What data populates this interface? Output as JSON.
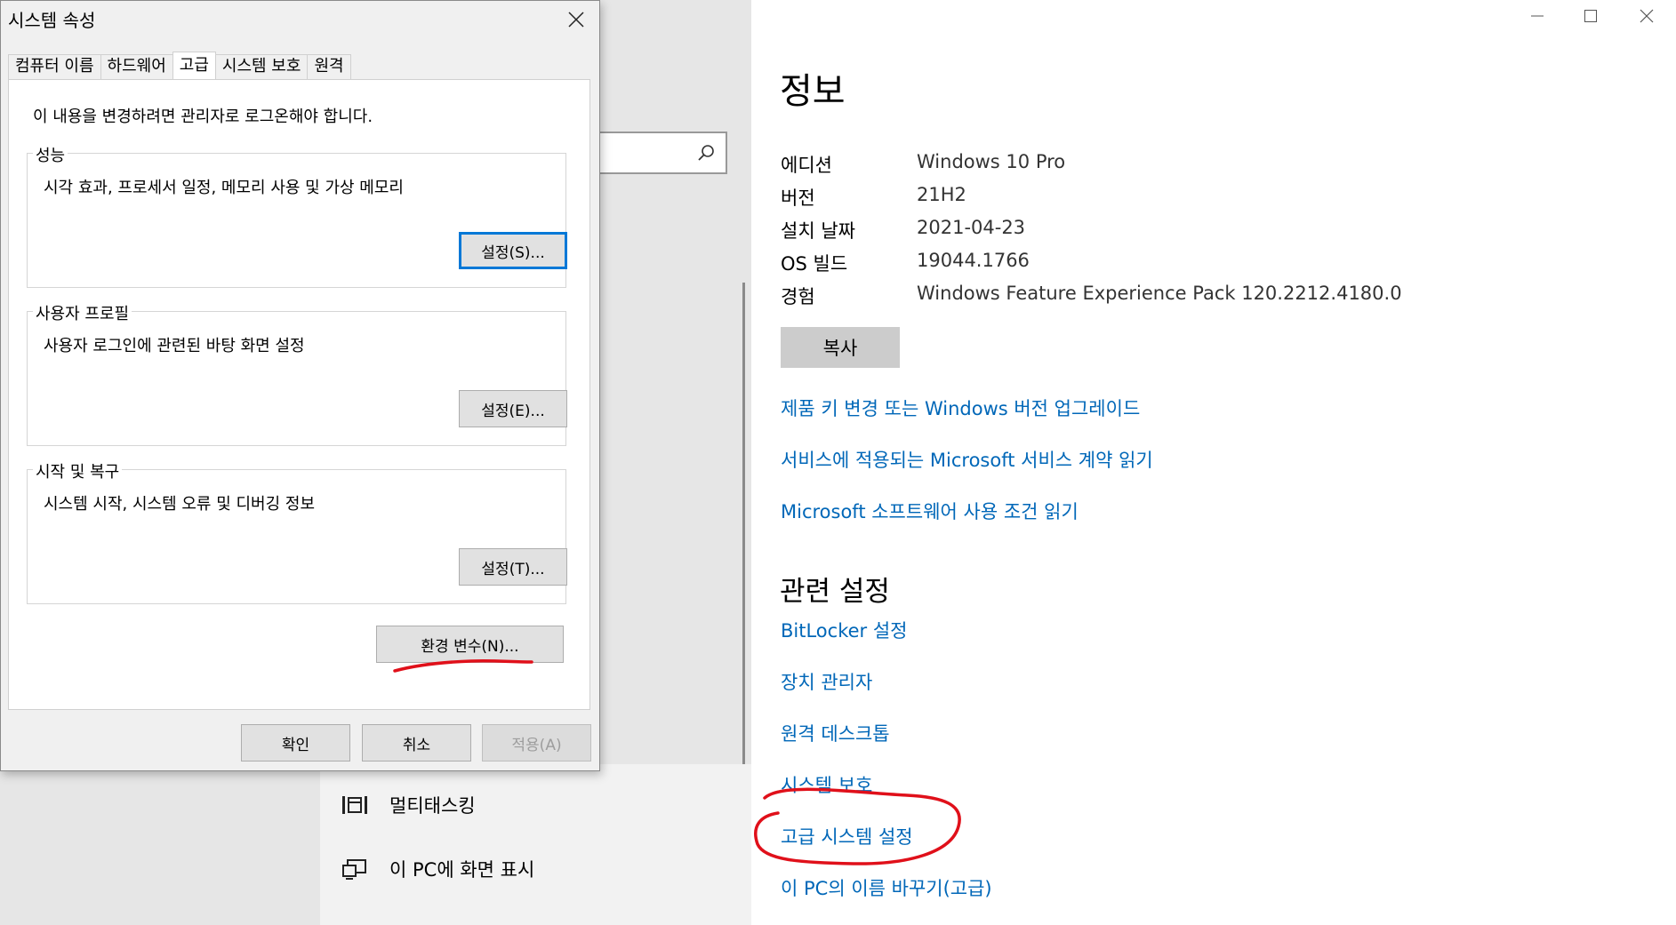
{
  "background": {
    "nav_items": [
      {
        "label": "멀티태스킹",
        "icon": "multitasking-icon"
      },
      {
        "label": "이 PC에 화면 표시",
        "icon": "project-icon"
      }
    ],
    "search_icon": "search-icon",
    "window_controls": [
      "minimize-icon",
      "maximize-icon",
      "close-icon"
    ],
    "title": "정보",
    "specs": [
      {
        "key": "에디션",
        "value": "Windows 10 Pro"
      },
      {
        "key": "버전",
        "value": "21H2"
      },
      {
        "key": "설치 날짜",
        "value": "2021-04-23"
      },
      {
        "key": "OS 빌드",
        "value": "19044.1766"
      },
      {
        "key": "경험",
        "value": "Windows Feature Experience Pack 120.2212.4180.0"
      }
    ],
    "copy_label": "복사",
    "links": [
      "제품 키 변경 또는 Windows 버전 업그레이드",
      "서비스에 적용되는 Microsoft 서비스 계약 읽기",
      "Microsoft 소프트웨어 사용 조건 읽기"
    ],
    "related_title": "관련 설정",
    "related_links": [
      "BitLocker 설정",
      "장치 관리자",
      "원격 데스크톱",
      "시스템 보호",
      "고급 시스템 설정",
      "이 PC의 이름 바꾸기(고급)"
    ],
    "link_color": "#0067b8"
  },
  "dialog": {
    "title": "시스템 속성",
    "tabs": [
      "컴퓨터 이름",
      "하드웨어",
      "고급",
      "시스템 보호",
      "원격"
    ],
    "active_tab": "고급",
    "admin_note": "이 내용을 변경하려면 관리자로 로그온해야 합니다.",
    "groups": [
      {
        "label": "성능",
        "desc": "시각 효과, 프로세서 일정, 메모리 사용 및 가상 메모리",
        "button": "설정(S)..."
      },
      {
        "label": "사용자 프로필",
        "desc": "사용자 로그인에 관련된 바탕 화면 설정",
        "button": "설정(E)..."
      },
      {
        "label": "시작 및 복구",
        "desc": "시스템 시작, 시스템 오류 및 디버깅 정보",
        "button": "설정(T)..."
      }
    ],
    "env_button": "환경 변수(N)...",
    "ok": "확인",
    "cancel": "취소",
    "apply": "적용(A)",
    "accent": "#0078d7"
  },
  "annotation_color": "#e0101a"
}
